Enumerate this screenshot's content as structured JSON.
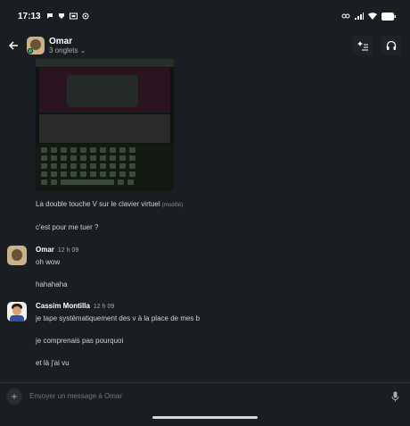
{
  "status_bar": {
    "time": "17:13"
  },
  "header": {
    "name": "Omar",
    "subtitle": "3 onglets ⌄"
  },
  "messages": [
    {
      "text": "La double touche V sur le clavier virtuel",
      "edited": "(modifié)"
    },
    {
      "text": "c'est pour me tuer ?"
    },
    {
      "author": "Omar",
      "time": "12 h 09",
      "lines": [
        "oh wow",
        "hahahaha"
      ]
    },
    {
      "author": "Cassim Montilla",
      "time": "12 h 09",
      "lines": [
        "je tape systématiquement des v à la place de mes b",
        "je comprenais pas pourquoi",
        "et là j'ai vu"
      ]
    }
  ],
  "composer": {
    "placeholder": "Envoyer un message à Omar"
  },
  "colors": {
    "background": "#1a1d21",
    "presence": "#2bac76"
  }
}
